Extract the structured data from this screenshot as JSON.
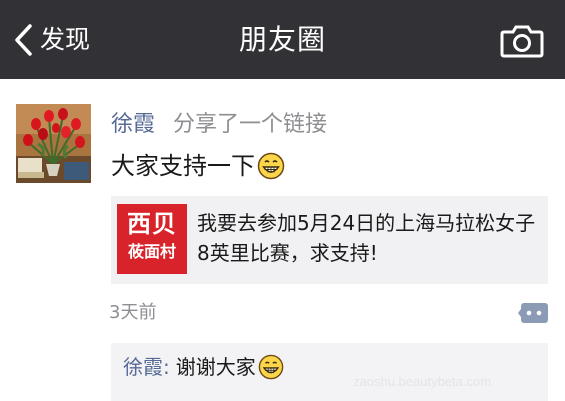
{
  "nav": {
    "back_label": "发现",
    "title": "朋友圈"
  },
  "post": {
    "author": "徐霞",
    "action": "分享了一个链接",
    "text": "大家支持一下",
    "time": "3天前",
    "link": {
      "logo_line1": "西贝",
      "logo_line2": "莜面村",
      "title": "我要去参加5月24日的上海马拉松女子8英里比赛，求支持!"
    },
    "comments": [
      {
        "author": "徐霞",
        "separator": ":",
        "text": "谢谢大家"
      }
    ]
  },
  "watermark": "zaoshu.beautybeta.com",
  "colors": {
    "navbar": "#323236",
    "username": "#566a95",
    "logo_red": "#d9232b",
    "card_bg": "#f1f1f3"
  },
  "icons": [
    "back-chevron-icon",
    "camera-icon",
    "grin-emoji-icon",
    "comment-menu-icon"
  ]
}
